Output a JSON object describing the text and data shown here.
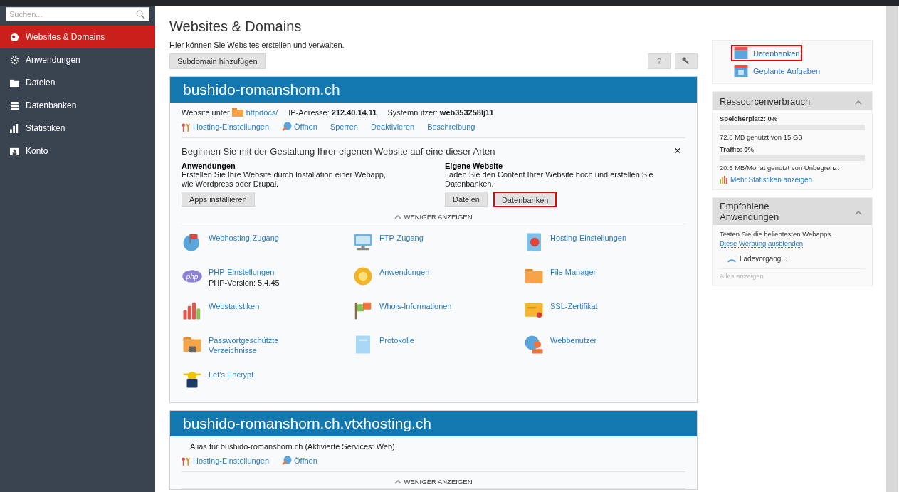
{
  "sidebar": {
    "search": {
      "placeholder": "Suchen..."
    },
    "items": [
      {
        "label": "Websites & Domains",
        "selected": true
      },
      {
        "label": "Anwendungen",
        "selected": false
      },
      {
        "label": "Dateien",
        "selected": false
      },
      {
        "label": "Datenbanken",
        "selected": false
      },
      {
        "label": "Statistiken",
        "selected": false
      },
      {
        "label": "Konto",
        "selected": false
      }
    ]
  },
  "page": {
    "title": "Websites & Domains",
    "description": "Hier können Sie Websites erstellen und verwalten.",
    "add_button": "Subdomain hinzufügen",
    "help_button": "?"
  },
  "domains": [
    {
      "name": "bushido-romanshorn.ch",
      "info": [
        {
          "kind": "folder",
          "label": "Website unter",
          "link": "httpdocs/"
        },
        {
          "kind": "text",
          "text": "IP-Adresse: **212.40.14.11**"
        },
        {
          "kind": "text",
          "text": "Systemnutzer: **web353258lj11**"
        }
      ],
      "links": [
        "Hosting-Einstellungen",
        "Öffnen",
        "Sperren",
        "Deaktivieren",
        "Beschreibung"
      ],
      "start": {
        "title": "Beginnen Sie mit der Gestaltung Ihrer eigenen Website auf eine dieser Arten",
        "close": "×",
        "columns": [
          {
            "heading": "Anwendungen",
            "text": "Erstellen Sie Ihre Website durch Installation einer Webapp, wie Wordpress oder Drupal.",
            "buttons": [
              {
                "label": "Apps installieren",
                "highlighted": false
              }
            ]
          },
          {
            "heading": "Eigene Website",
            "text": "Laden Sie den Content Ihrer Website hoch und erstellen Sie Datenbanken.",
            "buttons": [
              {
                "label": "Dateien",
                "highlighted": false
              },
              {
                "label": "Datenbanken",
                "highlighted": true
              }
            ]
          }
        ]
      },
      "toggle": "WENIGER ANZEIGEN",
      "expanded": true,
      "tools": [
        {
          "label": "Webhosting-Zugang"
        },
        {
          "label": "FTP-Zugang"
        },
        {
          "label": "Hosting-Einstellungen"
        },
        {
          "label": "PHP-Einstellungen",
          "badge": "php",
          "note": "PHP-Version: 5.4.45"
        },
        {
          "label": "Anwendungen"
        },
        {
          "label": "File Manager"
        },
        {
          "label": "Webstatistiken"
        },
        {
          "label": "Whois-Informationen"
        },
        {
          "label": "SSL-Zertifikat"
        },
        {
          "label": "Passwortgeschützte Verzeichnisse"
        },
        {
          "label": "Protokolle"
        },
        {
          "label": "Webbenutzer"
        },
        {
          "label": "Let's Encrypt"
        }
      ]
    },
    {
      "name": "bushido-romanshorn.ch.vtxhosting.ch",
      "info": [
        {
          "kind": "text",
          "text": "Alias für bushido-romanshorn.ch (Aktivierte Services: Web)"
        }
      ],
      "links": [
        "Hosting-Einstellungen",
        "Öffnen"
      ],
      "toggle": "WENIGER ANZEIGEN",
      "expanded": true
    }
  ],
  "right": {
    "shortcuts": [
      {
        "label": "Datenbanken",
        "highlighted": true
      },
      {
        "label": "Geplante Aufgaben",
        "highlighted": false
      }
    ],
    "resources": {
      "title": "Ressourcenverbrauch",
      "expanded": true,
      "meters": [
        {
          "label": "Speicherplatz: 0%",
          "level": 0,
          "reading": "72.8 MB genutzt von 15 GB"
        },
        {
          "label": "Traffic: 0%",
          "level": 0,
          "reading": "20.5 MB/Monat genutzt von Unbegrenzt"
        }
      ],
      "link": "Mehr Statistiken anzeigen"
    },
    "recommended": {
      "title": "Empfohlene Anwendungen",
      "expanded": true,
      "text": "Testen Sie die beliebtesten Webapps.",
      "link": "Diese Werbung ausblenden",
      "loading": "Ladevorgang...",
      "all": "Alles anzeigen"
    }
  }
}
